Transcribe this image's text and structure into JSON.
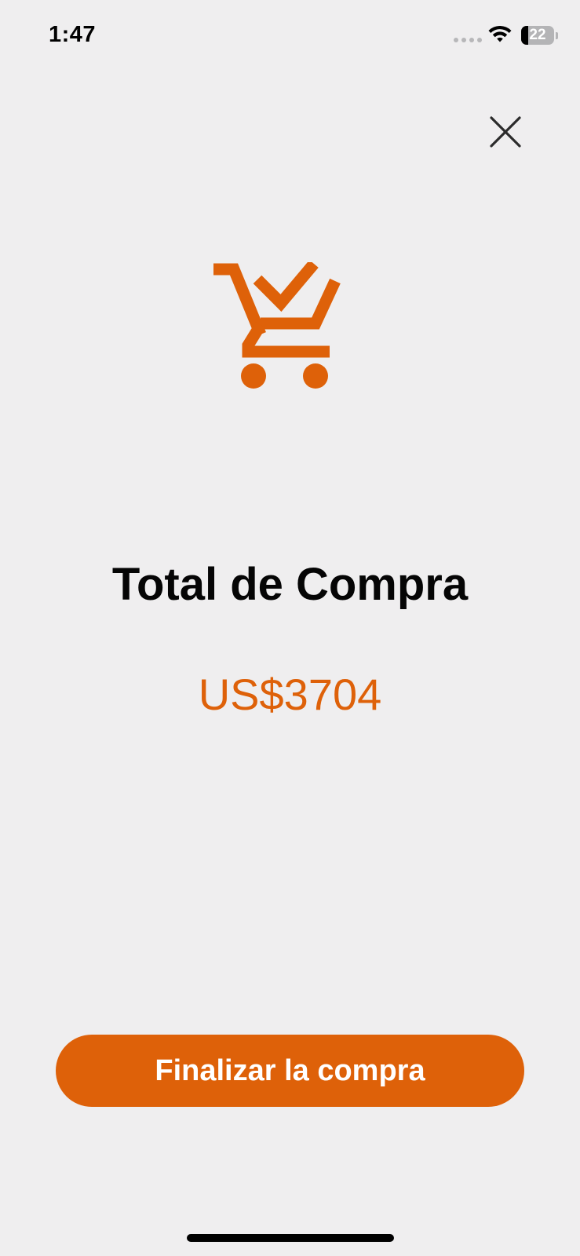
{
  "status_bar": {
    "time": "1:47",
    "battery_level": "22",
    "battery_fraction": 0.22,
    "icons": [
      "signal-icon",
      "wifi-icon",
      "battery-icon"
    ]
  },
  "header": {
    "close_icon": "close-icon"
  },
  "hero": {
    "icon": "cart-check-icon"
  },
  "summary": {
    "title": "Total de Compra",
    "amount": "US$3704"
  },
  "actions": {
    "checkout_label": "Finalizar la compra"
  },
  "colors": {
    "accent": "#de6109",
    "background": "#efeeef",
    "title_text": "#050505",
    "button_text": "#ffffff"
  }
}
